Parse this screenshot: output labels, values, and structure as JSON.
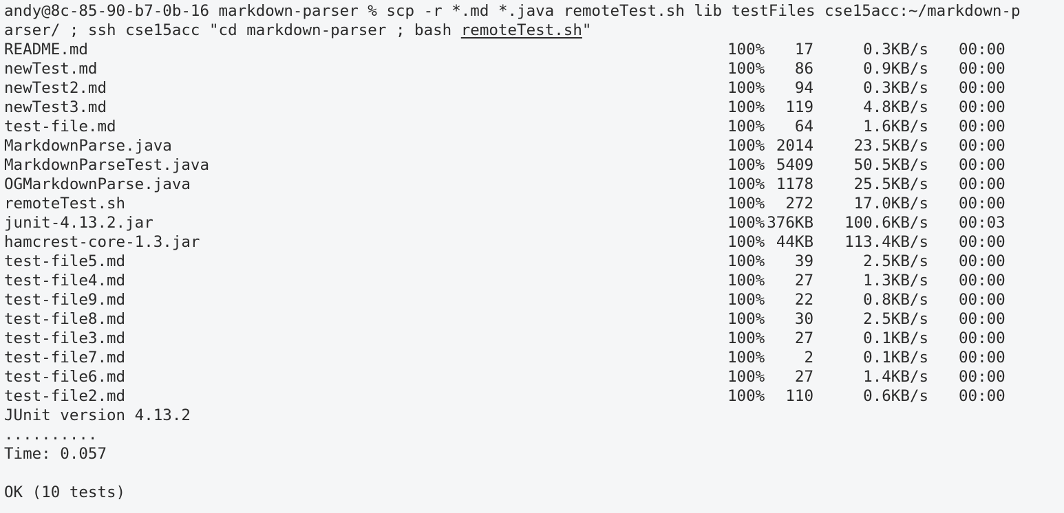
{
  "terminal": {
    "command_line_1": "andy@8c-85-90-b7-0b-16 markdown-parser % scp -r *.md *.java remoteTest.sh lib testFiles cse15acc:~/markdown-p",
    "command_line_2_prefix": "arser/ ; ssh cse15acc \"cd markdown-parser ; bash ",
    "command_line_2_link": "remoteTest.sh",
    "command_line_2_suffix": "\"",
    "transfers": [
      {
        "file": "README.md",
        "percent": "100%",
        "size": "17",
        "rate": "0.3KB/s",
        "time": "00:00"
      },
      {
        "file": "newTest.md",
        "percent": "100%",
        "size": "86",
        "rate": "0.9KB/s",
        "time": "00:00"
      },
      {
        "file": "newTest2.md",
        "percent": "100%",
        "size": "94",
        "rate": "0.3KB/s",
        "time": "00:00"
      },
      {
        "file": "newTest3.md",
        "percent": "100%",
        "size": "119",
        "rate": "4.8KB/s",
        "time": "00:00"
      },
      {
        "file": "test-file.md",
        "percent": "100%",
        "size": "64",
        "rate": "1.6KB/s",
        "time": "00:00"
      },
      {
        "file": "MarkdownParse.java",
        "percent": "100%",
        "size": "2014",
        "rate": "23.5KB/s",
        "time": "00:00"
      },
      {
        "file": "MarkdownParseTest.java",
        "percent": "100%",
        "size": "5409",
        "rate": "50.5KB/s",
        "time": "00:00"
      },
      {
        "file": "OGMarkdownParse.java",
        "percent": "100%",
        "size": "1178",
        "rate": "25.5KB/s",
        "time": "00:00"
      },
      {
        "file": "remoteTest.sh",
        "percent": "100%",
        "size": "272",
        "rate": "17.0KB/s",
        "time": "00:00"
      },
      {
        "file": "junit-4.13.2.jar",
        "percent": "100%",
        "size": "376KB",
        "rate": "100.6KB/s",
        "time": "00:03"
      },
      {
        "file": "hamcrest-core-1.3.jar",
        "percent": "100%",
        "size": "44KB",
        "rate": "113.4KB/s",
        "time": "00:00"
      },
      {
        "file": "test-file5.md",
        "percent": "100%",
        "size": "39",
        "rate": "2.5KB/s",
        "time": "00:00"
      },
      {
        "file": "test-file4.md",
        "percent": "100%",
        "size": "27",
        "rate": "1.3KB/s",
        "time": "00:00"
      },
      {
        "file": "test-file9.md",
        "percent": "100%",
        "size": "22",
        "rate": "0.8KB/s",
        "time": "00:00"
      },
      {
        "file": "test-file8.md",
        "percent": "100%",
        "size": "30",
        "rate": "2.5KB/s",
        "time": "00:00"
      },
      {
        "file": "test-file3.md",
        "percent": "100%",
        "size": "27",
        "rate": "0.1KB/s",
        "time": "00:00"
      },
      {
        "file": "test-file7.md",
        "percent": "100%",
        "size": "2",
        "rate": "0.1KB/s",
        "time": "00:00"
      },
      {
        "file": "test-file6.md",
        "percent": "100%",
        "size": "27",
        "rate": "1.4KB/s",
        "time": "00:00"
      },
      {
        "file": "test-file2.md",
        "percent": "100%",
        "size": "110",
        "rate": "0.6KB/s",
        "time": "00:00"
      }
    ],
    "junit_version": "JUnit version 4.13.2",
    "test_dots": "..........",
    "time_line": "Time: 0.057",
    "result": "OK (10 tests)"
  },
  "colors": {
    "background": "#f5f6f7",
    "text": "#2b2b2b"
  }
}
